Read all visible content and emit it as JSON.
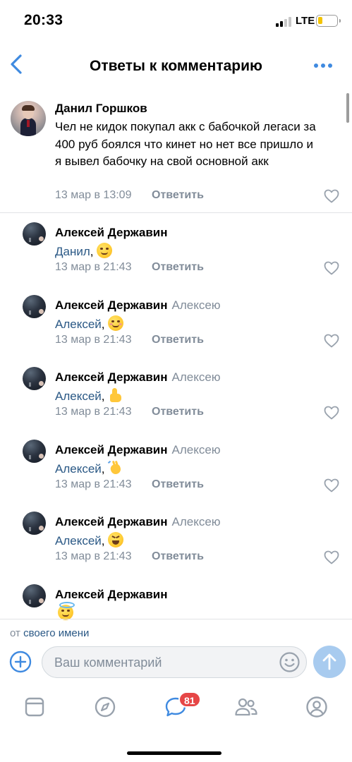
{
  "status_bar": {
    "time": "20:33",
    "network": "LTE",
    "battery_level": 0.2,
    "battery_color": "#f4c400"
  },
  "nav": {
    "back_icon": "chevron-left-icon",
    "title": "Ответы к комментарию",
    "more_icon": "more-dots-icon",
    "accent": "#3f8ae0"
  },
  "root_comment": {
    "author": "Данил Горшков",
    "text": "Чел не кидок покупал акк с бабочкой легаси за 400 руб боялся что кинет но нет все пришло и я вывел бабочку на свой основной акк",
    "date": "13 мар в 13:09",
    "reply_label": "Ответить"
  },
  "replies": [
    {
      "author": "Алексей Державин",
      "reply_to": "",
      "mention": "Данил",
      "separator": ",",
      "emoji": "smirk-emoji",
      "date": "13 мар в 21:43",
      "reply_label": "Ответить"
    },
    {
      "author": "Алексей Державин",
      "reply_to": "Алексею",
      "mention": "Алексей",
      "separator": ",",
      "emoji": "blush-emoji",
      "date": "13 мар в 21:43",
      "reply_label": "Ответить"
    },
    {
      "author": "Алексей Державин",
      "reply_to": "Алексею",
      "mention": "Алексей",
      "separator": ",",
      "emoji": "thumbs-up-emoji",
      "date": "13 мар в 21:43",
      "reply_label": "Ответить"
    },
    {
      "author": "Алексей Державин",
      "reply_to": "Алексею",
      "mention": "Алексей",
      "separator": ",",
      "emoji": "waving-hand-emoji",
      "date": "13 мар в 21:43",
      "reply_label": "Ответить"
    },
    {
      "author": "Алексей Державин",
      "reply_to": "Алексею",
      "mention": "Алексей",
      "separator": ",",
      "emoji": "squinting-laugh-emoji",
      "date": "13 мар в 21:43",
      "reply_label": "Ответить"
    },
    {
      "author": "Алексей Державин",
      "reply_to": "",
      "mention": "",
      "separator": "",
      "emoji": "halo-smile-emoji",
      "date": "",
      "reply_label": ""
    }
  ],
  "composer": {
    "from_prefix": "от",
    "from_link": "своего имени",
    "placeholder": "Ваш комментарий",
    "add_icon": "plus-circle-icon",
    "emoji_icon": "smile-icon",
    "send_icon": "send-arrow-icon"
  },
  "tab_bar": {
    "tabs": [
      "newsfeed-icon",
      "discover-icon",
      "messages-icon",
      "friends-icon",
      "profile-icon"
    ],
    "messages_badge": "81",
    "badge_color": "#e64646"
  }
}
